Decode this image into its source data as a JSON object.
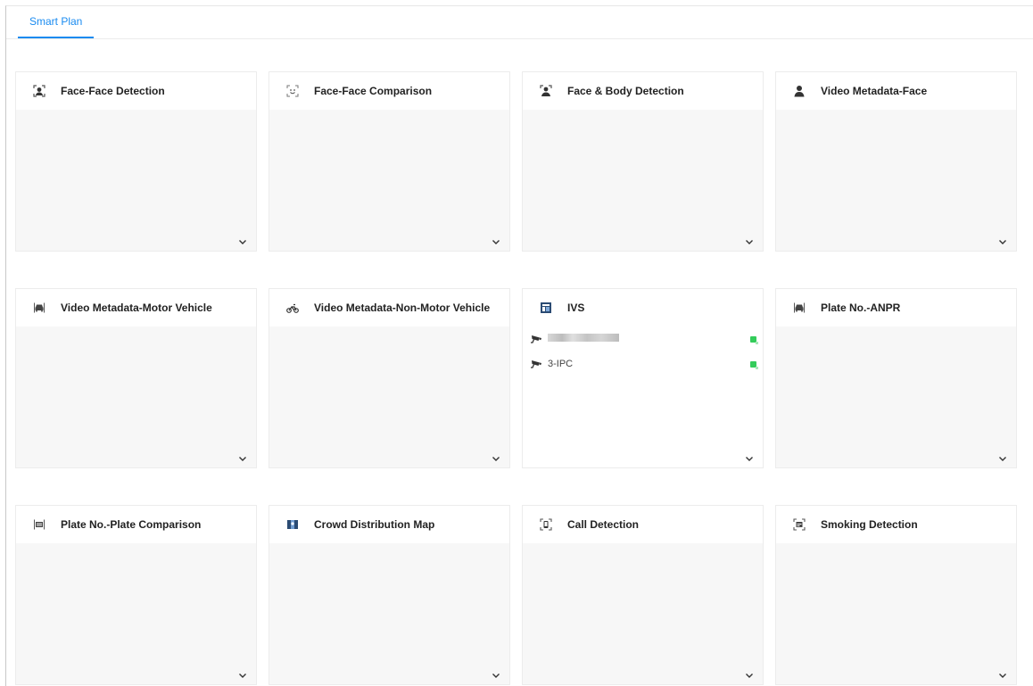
{
  "tabs": [
    {
      "label": "Smart Plan",
      "active": true
    }
  ],
  "cards": [
    {
      "title": "Face-Face Detection",
      "icon": "face-detection-icon"
    },
    {
      "title": "Face-Face Comparison",
      "icon": "face-comparison-icon"
    },
    {
      "title": "Face & Body Detection",
      "icon": "face-body-icon"
    },
    {
      "title": "Video Metadata-Face",
      "icon": "person-icon"
    },
    {
      "title": "Video Metadata-Motor Vehicle",
      "icon": "car-icon"
    },
    {
      "title": "Video Metadata-Non-Motor Vehicle",
      "icon": "bicycle-icon"
    },
    {
      "title": "IVS",
      "icon": "ivs-icon",
      "devices": [
        {
          "name": "",
          "status": "online"
        },
        {
          "name": "3-IPC",
          "status": "online"
        }
      ]
    },
    {
      "title": "Plate No.-ANPR",
      "icon": "car-icon"
    },
    {
      "title": "Plate No.-Plate Comparison",
      "icon": "plate-icon"
    },
    {
      "title": "Crowd Distribution Map",
      "icon": "crowd-map-icon"
    },
    {
      "title": "Call Detection",
      "icon": "phone-frame-icon"
    },
    {
      "title": "Smoking Detection",
      "icon": "smoking-frame-icon"
    }
  ],
  "colors": {
    "accent": "#1a8bf0",
    "online": "#33cc5a",
    "panel_bg": "#f7f7f7"
  }
}
